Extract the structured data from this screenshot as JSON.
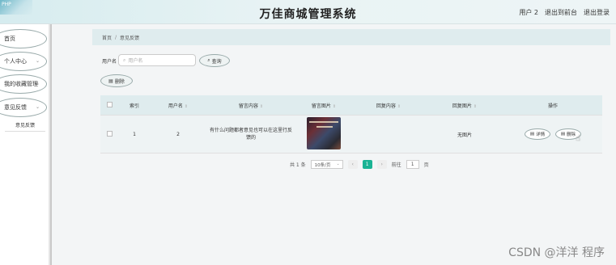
{
  "header": {
    "corner_text": "PHP",
    "title": "万佳商城管理系统",
    "links": [
      "用户 2",
      "退出到前台",
      "退出登录"
    ]
  },
  "sidebar": {
    "items": [
      {
        "label": "首页",
        "chevron": ""
      },
      {
        "label": "个人中心",
        "chevron": "⌄"
      },
      {
        "label": "我的收藏管理",
        "chevron": "⌄"
      },
      {
        "label": "意见反馈",
        "chevron": "⌄"
      }
    ],
    "sub_item": "意见反馈"
  },
  "breadcrumb": {
    "home": "首页",
    "separator": "/",
    "current": "意见反馈"
  },
  "filter": {
    "label": "用户名",
    "placeholder": "用户名",
    "search_label": "查询",
    "delete_label": "删除"
  },
  "table": {
    "headers": [
      "索引",
      "用户名",
      "留言内容",
      "留言图片",
      "回复内容",
      "回复图片",
      "操作"
    ],
    "rows": [
      {
        "index": "1",
        "username": "2",
        "content": "有什么问题都者意见也可以在这里行反馈的",
        "reply_image": "无图片",
        "detail_label": "详情",
        "delete_label": "删除"
      }
    ]
  },
  "pagination": {
    "total": "共 1 条",
    "page_size": "10条/页",
    "prev": "‹",
    "current": "1",
    "next": "›",
    "goto_prefix": "前往",
    "goto_value": "1",
    "goto_suffix": "页"
  },
  "watermark": "CSDN @洋洋  程序",
  "colors": {
    "accent": "#1ab394",
    "header_bg": "#dfecee"
  }
}
